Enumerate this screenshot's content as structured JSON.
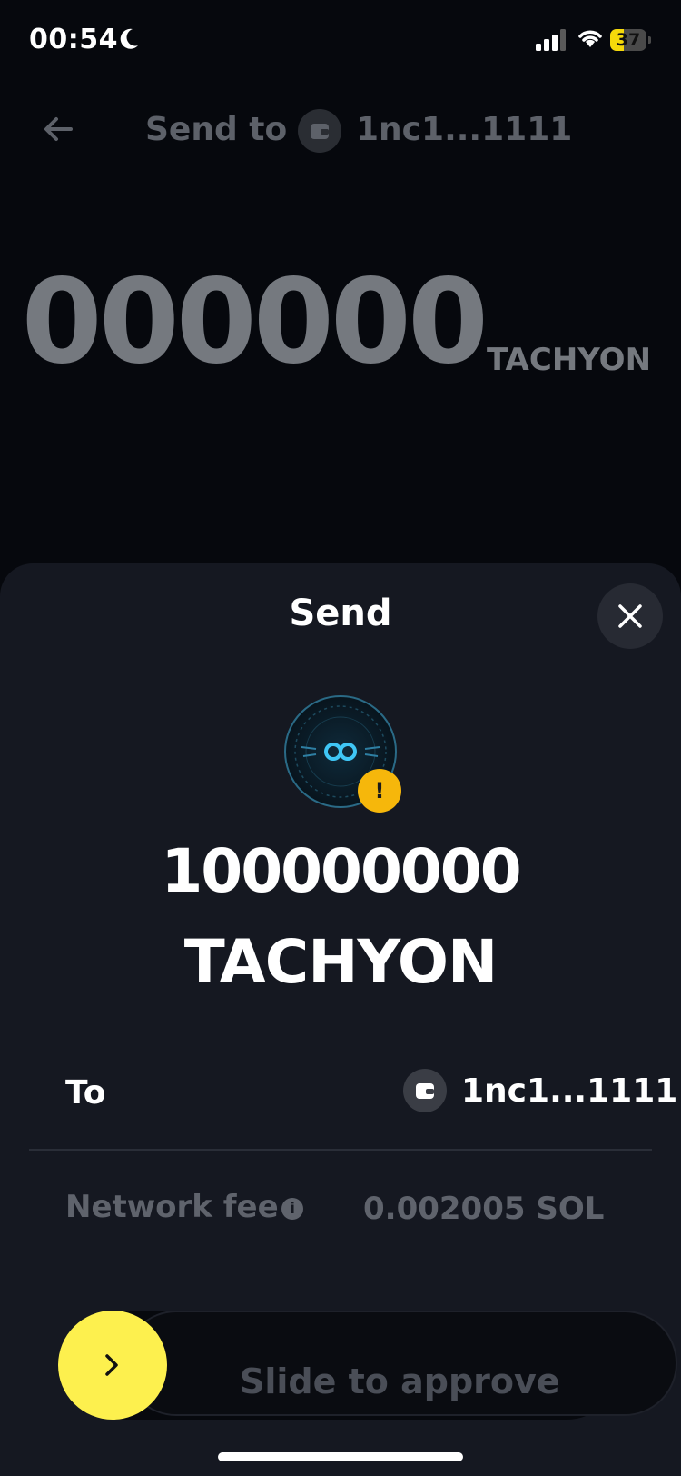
{
  "status_bar": {
    "time": "00:54",
    "battery_level": "37",
    "battery_fraction": 0.37,
    "icons": [
      "moon-icon",
      "signal-icon",
      "wifi-icon",
      "battery-icon"
    ]
  },
  "background": {
    "send_to_label": "Send to",
    "recipient_short": "1nc1...1111",
    "amount_display": "000000",
    "unit": "TACHYON"
  },
  "sheet": {
    "title": "Send",
    "amount": "100000000",
    "token": "TACHYON",
    "to_label": "To",
    "to_address": "1nc1...1111",
    "fee_label": "Network fee",
    "fee_value": "0.002005 SOL",
    "slider_label": "Slide to approve"
  },
  "colors": {
    "background": "#06080d",
    "sheet": "#151821",
    "slider_accent": "#fdf04e",
    "warning": "#f6b70b"
  }
}
